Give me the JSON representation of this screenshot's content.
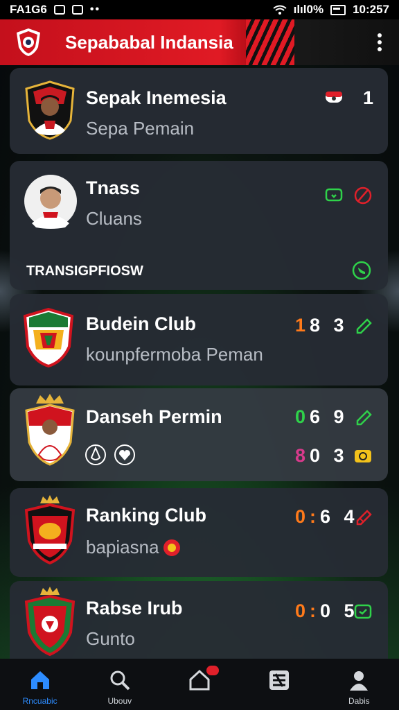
{
  "status_bar": {
    "left_text": "FA1G6",
    "time": "10:257",
    "signal_text": "ılıl0%"
  },
  "app_bar": {
    "title": "Sepababal Indansia"
  },
  "cards": [
    {
      "name": "Sepak Inemesia",
      "subtitle": "Sepa Pemain",
      "score": "1"
    },
    {
      "name": "Tnass",
      "subtitle": "Cluans"
    },
    {
      "name": "Budein Club",
      "subtitle": "kounpfermoba Peman",
      "score_parts": [
        "1",
        "8 3"
      ]
    },
    {
      "name": "Danseh Permin",
      "score_parts": [
        "0",
        "6 9"
      ],
      "score2_parts": [
        "8",
        "0 3"
      ]
    },
    {
      "name": "Ranking Club",
      "subtitle": "bapiasna",
      "score_parts": [
        "0:",
        "6 4"
      ]
    },
    {
      "name": "Rabse Irub",
      "subtitle": "Gunto",
      "score_parts": [
        "0:",
        "0 5"
      ]
    }
  ],
  "section": {
    "label": "TRANSIGPFIOSW"
  },
  "bottom_nav": {
    "items": [
      {
        "label": "Rncuabic",
        "icon": "home-icon"
      },
      {
        "label": "Ubouv",
        "icon": "search-icon"
      },
      {
        "label": "",
        "icon": "house-outline-icon"
      },
      {
        "label": "",
        "icon": "grid-icon"
      },
      {
        "label": "Dabis",
        "icon": "profile-icon"
      }
    ]
  },
  "colors": {
    "accent_red": "#e01a24",
    "green": "#2fd24a",
    "orange": "#ff7a1a",
    "magenta": "#d93a8c",
    "yellow": "#f3c21b",
    "nav_active": "#2d8cff"
  }
}
